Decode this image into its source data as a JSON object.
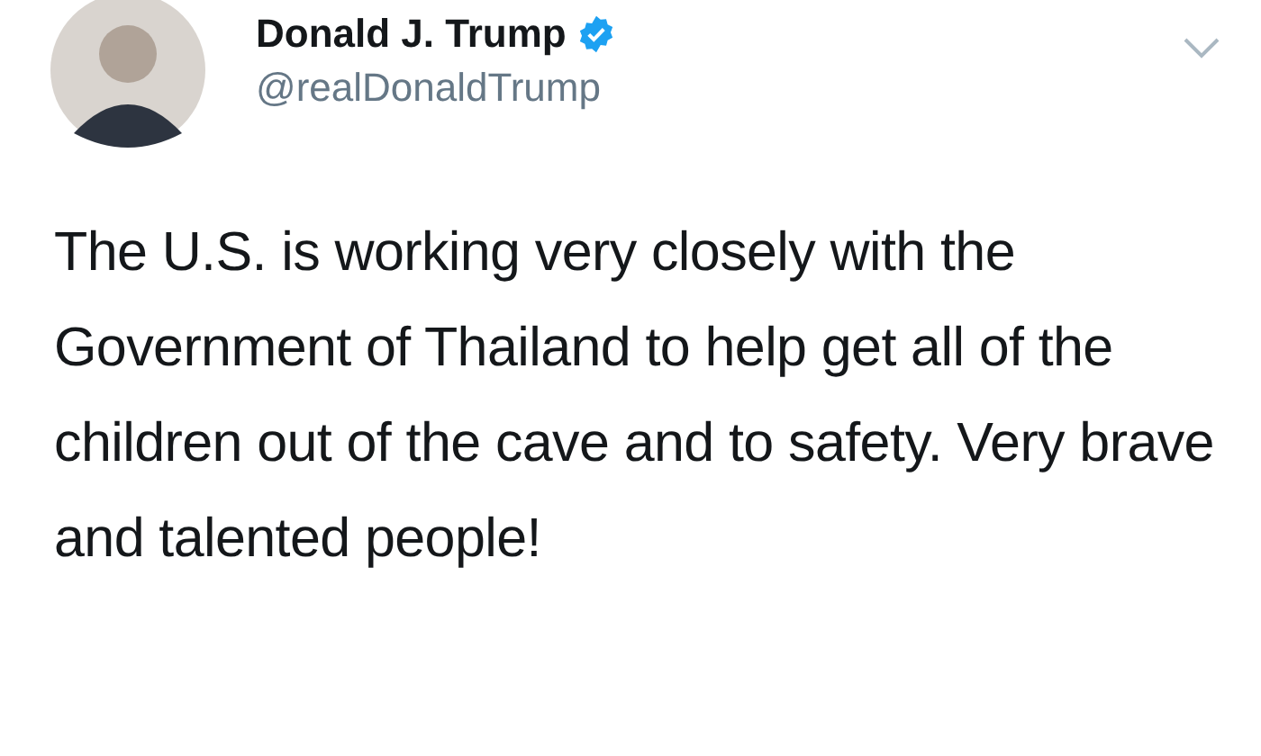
{
  "tweet": {
    "name": "Donald J. Trump",
    "verified": true,
    "handle": "@realDonaldTrump",
    "text": "The U.S. is working very closely with the Government of Thailand to help get all of the children out of the cave and to safety. Very brave and talented people!"
  }
}
